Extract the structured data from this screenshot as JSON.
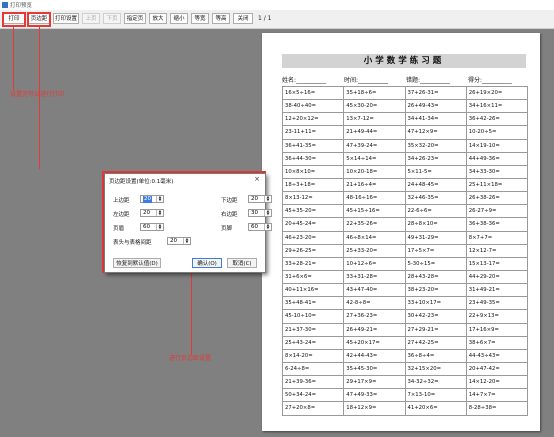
{
  "window": {
    "title": "打印预览"
  },
  "toolbar": {
    "buttons": [
      "打印",
      "页边距",
      "打印设置",
      "上页",
      "下页",
      "指定页",
      "放大",
      "缩小",
      "等宽",
      "等高",
      "关闭"
    ],
    "page_counter": "1 / 1"
  },
  "annotations": {
    "print_note": "设置完可以进行打印",
    "margin_note": "进行页边距设置"
  },
  "page": {
    "title": "小学数学练习题",
    "info": [
      "姓名:__________",
      "时间:__________",
      "错题:__________",
      "得分:__________"
    ],
    "rows": [
      [
        "16×5÷16=",
        "35+18÷6=",
        "37+26-31=",
        "26+19×20="
      ],
      [
        "38-40÷40=",
        "45×30-20=",
        "26+49-43=",
        "34+16×11="
      ],
      [
        "12+20×12=",
        "13×7-12=",
        "34+41-34=",
        "36+42-26="
      ],
      [
        "23-11+11=",
        "21+49-44=",
        "47+12×9=",
        "10-20÷5="
      ],
      [
        "36+41-35=",
        "47+39-24=",
        "35×32-20=",
        "14×19-10="
      ],
      [
        "36+44-30=",
        "5×14÷14=",
        "34+26-23=",
        "44+49-36="
      ],
      [
        "10×8×10=",
        "10×20-18=",
        "5×11-5=",
        "34+33-30="
      ],
      [
        "18÷3+18=",
        "21+16÷4=",
        "24+48-45=",
        "25+11×18="
      ],
      [
        "8×13-12=",
        "48-16÷16=",
        "32+46-35=",
        "26+38-26="
      ],
      [
        "45+35-20=",
        "45+15÷16=",
        "22-6÷6=",
        "26-27÷9="
      ],
      [
        "20+45-24=",
        "22+35-26=",
        "28÷8×10=",
        "36+38-36="
      ],
      [
        "46+23-20=",
        "46÷8×14=",
        "49+31-29=",
        "8×7+7="
      ],
      [
        "29+26-25=",
        "25+33-20=",
        "17÷5×7=",
        "12×12-7="
      ],
      [
        "33+28-21=",
        "10+12÷6=",
        "5-30÷15=",
        "15×13-17="
      ],
      [
        "31+6×6=",
        "33+31-28=",
        "28+43-28=",
        "44+29-20="
      ],
      [
        "40+11×16=",
        "43+47-40=",
        "38+23-20=",
        "31+49-21="
      ],
      [
        "35+48-41=",
        "42-8÷8=",
        "33+10×17=",
        "23+49-35="
      ],
      [
        "45-10÷10=",
        "27+36-23=",
        "30+42-23=",
        "22+9×13="
      ],
      [
        "21+37-30=",
        "26+49-21=",
        "27+29-21=",
        "17+16×9="
      ],
      [
        "25+43-24=",
        "45+20×17=",
        "27+42-25=",
        "38+6×7="
      ],
      [
        "8×14-20=",
        "42+44-43=",
        "36÷8÷4=",
        "44-43÷43="
      ],
      [
        "6-24÷8=",
        "35+45-30=",
        "32+15×20=",
        "20+47-42="
      ],
      [
        "21+39-36=",
        "29+17×9=",
        "34-32÷32=",
        "14×12-20="
      ],
      [
        "50+34-24=",
        "47+49-33=",
        "7×13-10=",
        "14+7×7="
      ],
      [
        "27+20×8=",
        "18+12×9=",
        "41+20×6=",
        "8-28÷38="
      ]
    ]
  },
  "dialog": {
    "title": "页边距设置(单位:0.1毫米)",
    "fields": {
      "top": {
        "label": "上边距",
        "value": "20"
      },
      "bottom": {
        "label": "下边距",
        "value": "20"
      },
      "left": {
        "label": "左边距",
        "value": "20"
      },
      "right": {
        "label": "右边距",
        "value": "30"
      },
      "header": {
        "label": "页眉",
        "value": "60"
      },
      "footer": {
        "label": "页脚",
        "value": "60"
      },
      "header_table_gap": {
        "label": "表头与表格间距",
        "value": "20"
      }
    },
    "buttons": {
      "restore": "恢复到默认值(D)",
      "ok": "确认(O)",
      "cancel": "取消(C)"
    }
  }
}
